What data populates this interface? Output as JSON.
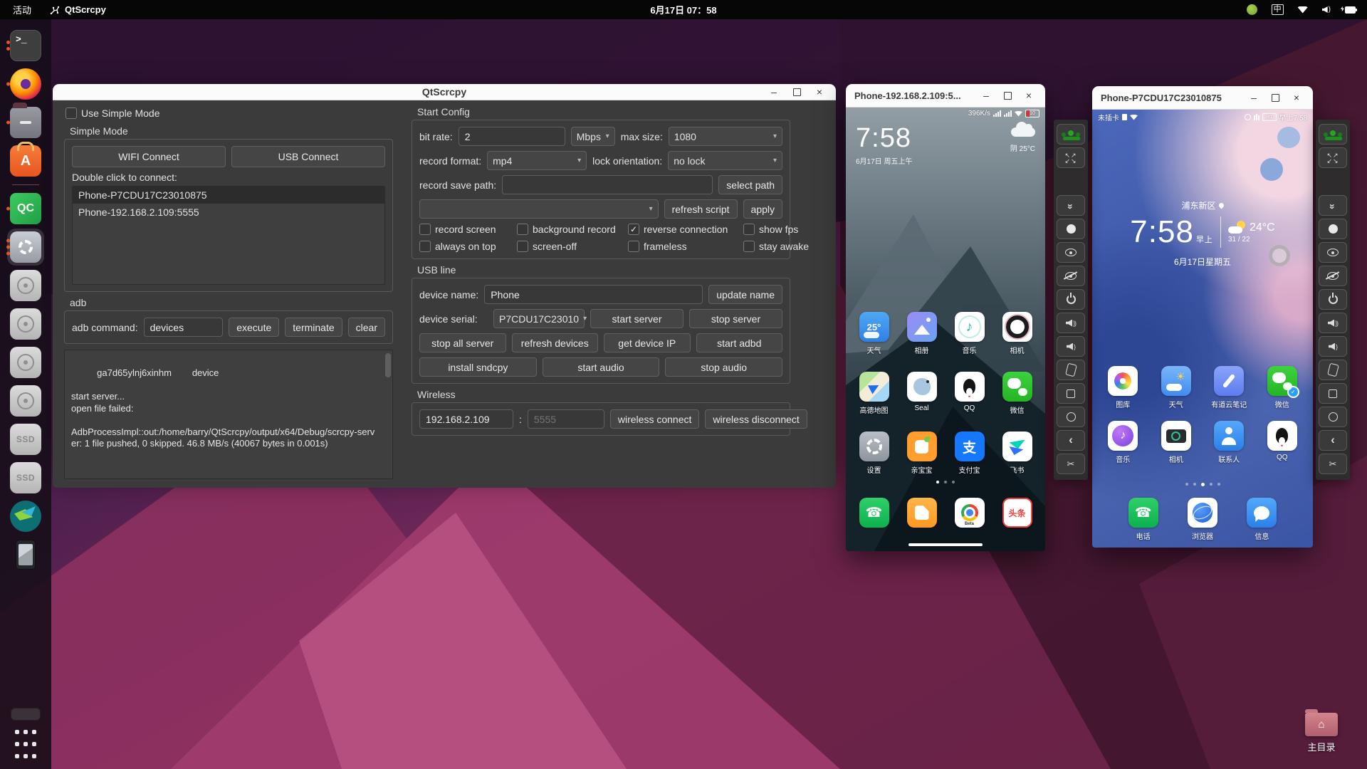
{
  "topbar": {
    "activities": "活动",
    "app": "QtScrcpy",
    "clock": "6月17日 07：58",
    "ime": "中"
  },
  "dock": {
    "ssd": "SSD"
  },
  "qt": {
    "title": "QtScrcpy",
    "use_simple": "Use Simple Mode",
    "simple_mode": "Simple Mode",
    "wifi": "WIFI Connect",
    "usb": "USB Connect",
    "dbl": "Double click to connect:",
    "devices": [
      "Phone-P7CDU17C23010875",
      "Phone-192.168.2.109:5555"
    ],
    "adb": "adb",
    "adb_cmd": "adb command:",
    "adb_val": "devices",
    "execute": "execute",
    "terminate": "terminate",
    "clear": "clear",
    "log": "ga7d65ylnj6xinhm        device\n\nstart server...\nopen file failed:\n\nAdbProcessImpl::out:/home/barry/QtScrcpy/output/x64/Debug/scrcpy-server: 1 file pushed, 0 skipped. 46.8 MB/s (40067 bytes in 0.001s)",
    "sc": {
      "title": "Start Config",
      "bitrate_l": "bit rate:",
      "bitrate_v": "2",
      "mbps": "Mbps",
      "maxsize_l": "max size:",
      "maxsize_v": "1080",
      "fmt_l": "record format:",
      "fmt_v": "mp4",
      "lock_l": "lock orientation:",
      "lock_v": "no lock",
      "path_l": "record save path:",
      "select_path": "select path",
      "refresh_script": "refresh script",
      "apply": "apply",
      "cb": [
        "record screen",
        "background record",
        "reverse connection",
        "show fps",
        "always on top",
        "screen-off",
        "frameless",
        "stay awake"
      ]
    },
    "ul": {
      "title": "USB line",
      "name_l": "device name:",
      "name_v": "Phone",
      "update": "update name",
      "serial_l": "device serial:",
      "serial_v": "P7CDU17C23010",
      "start_server": "start server",
      "stop_server": "stop server",
      "stop_all": "stop all server",
      "refresh_devices": "refresh devices",
      "get_ip": "get device IP",
      "start_adbd": "start adbd",
      "install": "install sndcpy",
      "start_audio": "start audio",
      "stop_audio": "stop audio"
    },
    "wl": {
      "title": "Wireless",
      "ip": "192.168.2.109",
      "colon": ":",
      "port": "5555",
      "connect": "wireless connect",
      "disconnect": "wireless disconnect"
    }
  },
  "p1": {
    "title": "Phone-192.168.2.109:5...",
    "speed": "396K/s",
    "battery": "10",
    "clock": "7:58",
    "date": "6月17日 周五上午",
    "weather": "阴 25°C",
    "apps": [
      {
        "label": "天气",
        "glyph": "25°"
      },
      {
        "label": "相册"
      },
      {
        "label": "音乐"
      },
      {
        "label": "相机"
      },
      {
        "label": "高德地图"
      },
      {
        "label": "Seal"
      },
      {
        "label": "QQ"
      },
      {
        "label": "微信"
      },
      {
        "label": "设置"
      },
      {
        "label": "亲宝宝"
      },
      {
        "label": "支付宝",
        "glyph": "支"
      },
      {
        "label": "飞书"
      }
    ],
    "chrome_badge": "Beta",
    "toutiao": "头条"
  },
  "p2": {
    "title": "Phone-P7CDU17C23010875",
    "sim": "未插卡",
    "battery": "90",
    "time": "早上7:58",
    "location": "浦东新区",
    "clock": "7:58",
    "ampm": "早上",
    "temp": "24°C",
    "hilo": "31 / 22",
    "date": "6月17日星期五",
    "apps": [
      {
        "label": "图库"
      },
      {
        "label": "天气"
      },
      {
        "label": "有道云笔记"
      },
      {
        "label": "微信"
      },
      {
        "label": "音乐"
      },
      {
        "label": "相机"
      },
      {
        "label": "联系人"
      },
      {
        "label": "QQ"
      }
    ],
    "dock": [
      {
        "label": "电话"
      },
      {
        "label": "浏览器"
      },
      {
        "label": "信息"
      }
    ]
  },
  "desk": {
    "home": "主目录"
  }
}
